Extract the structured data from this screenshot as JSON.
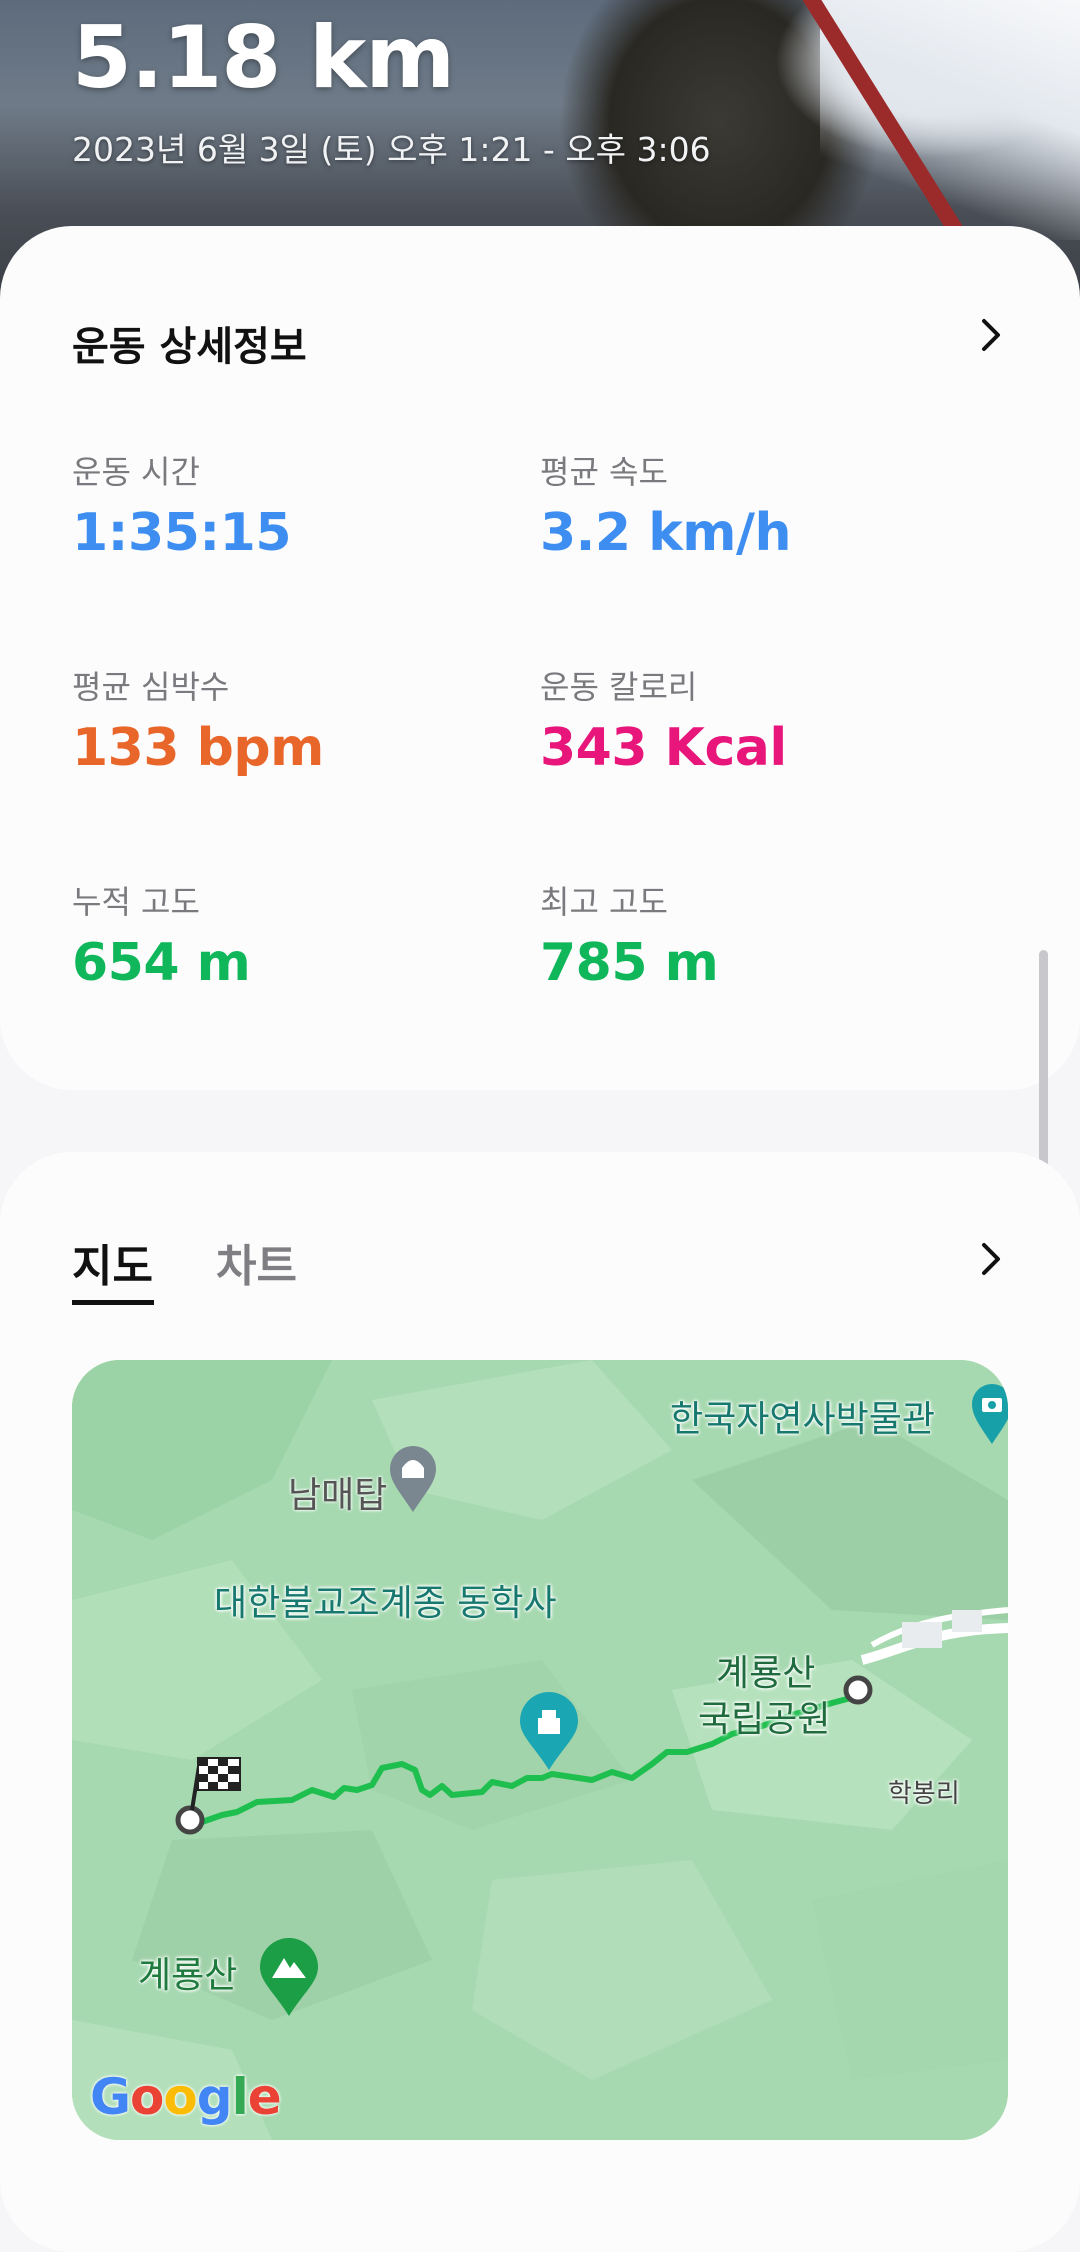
{
  "header": {
    "distance": "5.18 km",
    "date_range": "2023년 6월 3일 (토) 오후 1:21 - 오후 3:06"
  },
  "details": {
    "title": "운동 상세정보",
    "stats": [
      {
        "label": "운동 시간",
        "value": "1:35:15",
        "color": "#3d8ef0"
      },
      {
        "label": "평균 속도",
        "value": "3.2 km/h",
        "color": "#3d8ef0"
      },
      {
        "label": "평균 심박수",
        "value": "133 bpm",
        "color": "#e8662a"
      },
      {
        "label": "운동 칼로리",
        "value": "343 Kcal",
        "color": "#e8157a"
      },
      {
        "label": "누적 고도",
        "value": "654 m",
        "color": "#0fb75a"
      },
      {
        "label": "최고 고도",
        "value": "785 m",
        "color": "#0fb75a"
      }
    ]
  },
  "tabs": {
    "map_label": "지도",
    "chart_label": "차트",
    "active": "지도"
  },
  "map": {
    "places": [
      "한국자연사박물관",
      "남매탑",
      "대한불교조계종 동학사",
      "계룡산 국립공원",
      "학봉리",
      "계룡산"
    ],
    "park_line1": "계룡산",
    "park_line2": "국립공원",
    "attribution": "Google",
    "route_color": "#1fbf4f"
  },
  "icons": {
    "details_chevron": "chevron-right-icon",
    "map_chevron": "chevron-right-icon",
    "finish_flag": "checkered-flag-icon",
    "museum_pin": "museum-pin-icon",
    "pagoda_pin": "pagoda-pin-icon",
    "temple_pin": "temple-pin-icon",
    "mountain_pin": "mountain-pin-icon"
  }
}
